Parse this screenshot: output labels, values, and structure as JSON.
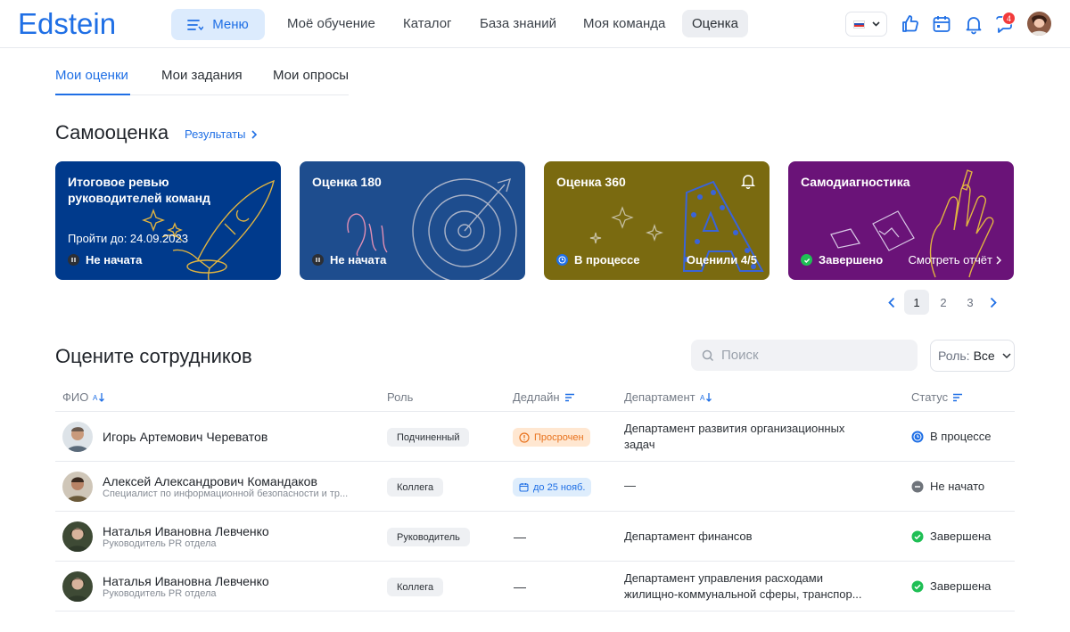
{
  "brand": {
    "logo_text": "Edstein",
    "accent": "#1f6fe5"
  },
  "topbar": {
    "menu_label": "Меню",
    "nav": [
      "Моё обучение",
      "Каталог",
      "База знаний",
      "Моя команда",
      "Оценка"
    ],
    "active_nav": "Оценка",
    "language": "ru",
    "notification_count": "4",
    "icons": [
      "like-icon",
      "calendar-icon",
      "bell-icon",
      "chat-icon"
    ]
  },
  "tabs": [
    "Мои оценки",
    "Мои задания",
    "Мои опросы"
  ],
  "active_tab": "Мои оценки",
  "self_assessment": {
    "title": "Самооценка",
    "results_link": "Результаты",
    "cards": [
      {
        "title": "Итоговое ревью руководителей команд",
        "deadline": "Пройти до: 24.09.2023",
        "status": "Не начата",
        "status_icon": "pause-icon",
        "color": "#003a8c"
      },
      {
        "title": "Оценка 180",
        "status": "Не начата",
        "status_icon": "pause-icon",
        "color": "#1e4d8e"
      },
      {
        "title": "Оценка 360",
        "status": "В процессе",
        "status_icon": "clock-icon",
        "right_text": "Оценили 4/5",
        "color": "#7a6a10"
      },
      {
        "title": "Самодиагностика",
        "status": "Завершено",
        "status_icon": "check-icon",
        "right_text": "Смотреть отчёт",
        "color": "#6a1378"
      }
    ]
  },
  "pagination": {
    "pages": [
      "1",
      "2",
      "3"
    ],
    "current": "1"
  },
  "employees": {
    "title": "Оцените сотрудников",
    "search_placeholder": "Поиск",
    "role_filter": {
      "label": "Роль:",
      "value": "Все"
    },
    "columns": [
      "ФИО",
      "Роль",
      "Дедлайн",
      "Департамент",
      "Статус"
    ],
    "rows": [
      {
        "name": "Игорь Артемович Череватов",
        "position": "",
        "role": "Подчиненный",
        "deadline": "Просрочен",
        "deadline_type": "overdue",
        "department": "Департамент развития организационных задач",
        "status": "В процессе",
        "status_type": "in-progress"
      },
      {
        "name": "Алексей Александрович Командаков",
        "position": "Специалист по информационной безопасности и тр...",
        "role": "Коллега",
        "deadline": "до 25 нояб.",
        "deadline_type": "date",
        "department": "—",
        "status": "Не начато",
        "status_type": "not-started"
      },
      {
        "name": "Наталья Ивановна Левченко",
        "position": "Руководитель PR отдела",
        "role": "Руководитель",
        "deadline": "—",
        "deadline_type": "none",
        "department": "Департамент финансов",
        "status": "Завершена",
        "status_type": "done"
      },
      {
        "name": "Наталья Ивановна Левченко",
        "position": "Руководитель PR отдела",
        "role": "Коллега",
        "deadline": "—",
        "deadline_type": "none",
        "department": "Департамент управления расходами жилищно-коммунальной сферы, транспор...",
        "status": "Завершена",
        "status_type": "done"
      }
    ]
  }
}
